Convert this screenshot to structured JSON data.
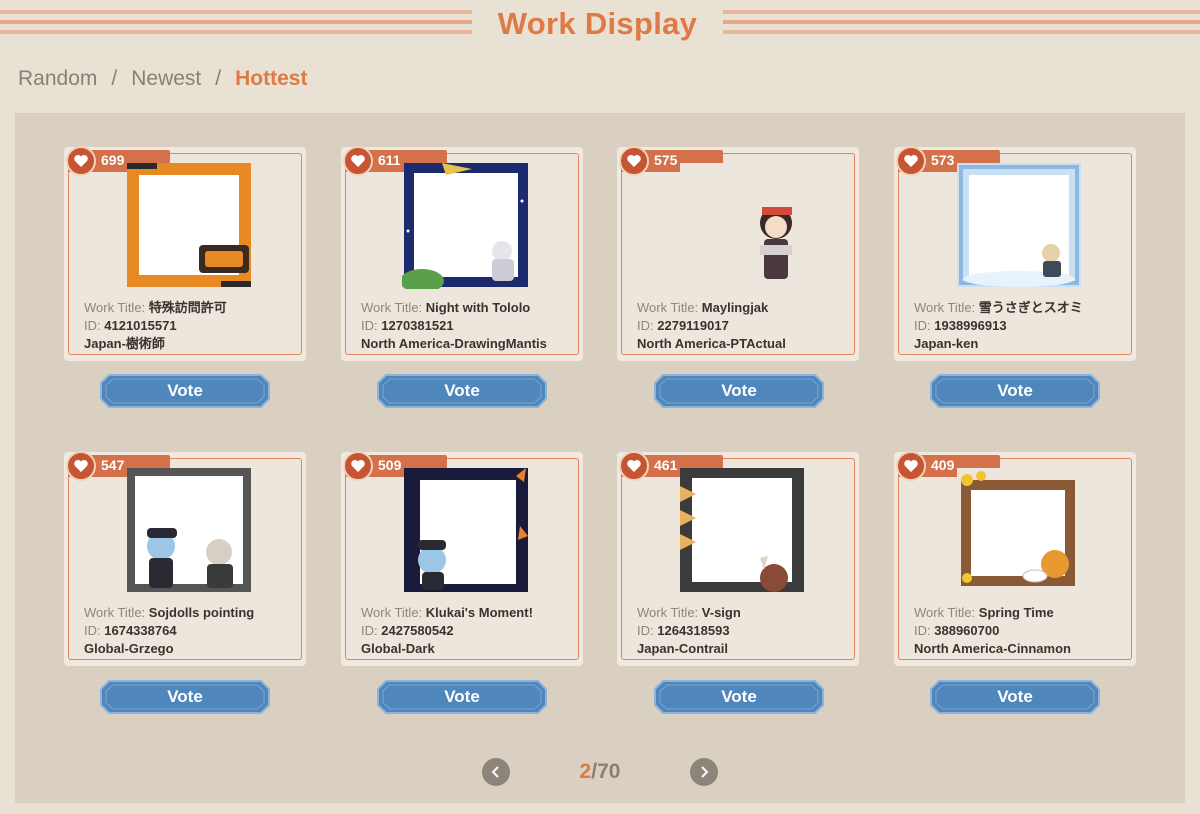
{
  "header": {
    "title": "Work Display"
  },
  "tabs": [
    {
      "label": "Random"
    },
    {
      "label": "Newest"
    },
    {
      "label": "Hottest"
    }
  ],
  "labels": {
    "work_title": "Work Title:",
    "id": "ID:",
    "vote": "Vote"
  },
  "cards": [
    {
      "likes": "699",
      "title": "特殊訪問許可",
      "id": "4121015571",
      "region": "Japan-樹術師",
      "frame_color": "#e88a24"
    },
    {
      "likes": "611",
      "title": "Night with Tololo",
      "id": "1270381521",
      "region": "North America-DrawingMantis",
      "frame_color": "#1c2a6e"
    },
    {
      "likes": "575",
      "title": "Maylingjak",
      "id": "2279119017",
      "region": "North America-PTActual",
      "frame_color": "#ffffff"
    },
    {
      "likes": "573",
      "title": "雪うさぎとスオミ",
      "id": "1938996913",
      "region": "Japan-ken",
      "frame_color": "#a9cdee"
    },
    {
      "likes": "547",
      "title": "Sojdolls pointing",
      "id": "1674338764",
      "region": "Global-Grzego",
      "frame_color": "#555555"
    },
    {
      "likes": "509",
      "title": "Klukai's Moment!",
      "id": "2427580542",
      "region": "Global-Dark",
      "frame_color": "#1a1a3a"
    },
    {
      "likes": "461",
      "title": "V-sign",
      "id": "1264318593",
      "region": "Japan-Contrail",
      "frame_color": "#3b3b3b"
    },
    {
      "likes": "409",
      "title": "Spring Time",
      "id": "388960700",
      "region": "North America-Cinnamon",
      "frame_color": "#8a5a36"
    }
  ],
  "pager": {
    "current": "2",
    "total": "/70"
  },
  "colors": {
    "accent": "#de7a45",
    "vote": "#4f86bb",
    "like_badge": "#d4714a"
  }
}
